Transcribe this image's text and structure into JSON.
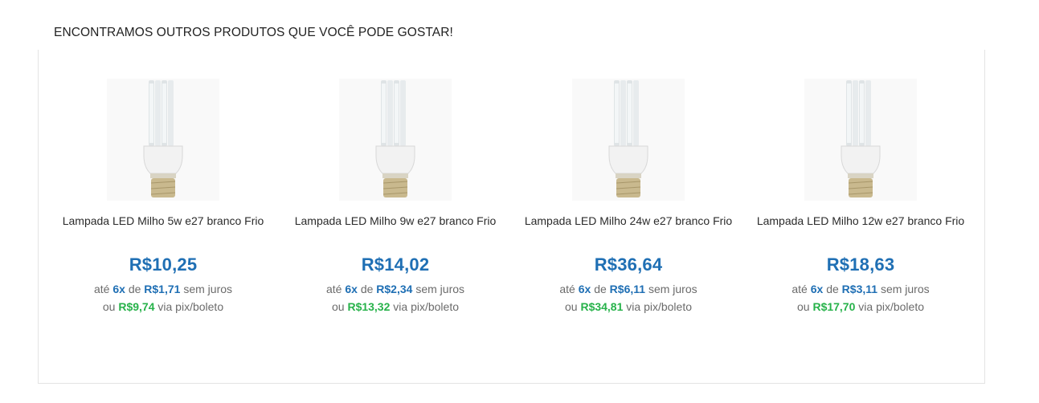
{
  "section": {
    "title": "ENCONTRAMOS OUTROS PRODUTOS QUE VOCÊ PODE GOSTAR!"
  },
  "labels": {
    "ate": "até",
    "de": "de",
    "sem_juros": "sem juros",
    "ou": "ou",
    "via_pix": "via pix/boleto"
  },
  "products": [
    {
      "name": "Lampada LED Milho 5w e27 branco Frio",
      "price": "R$10,25",
      "installments": "6x",
      "installment_value": "R$1,71",
      "pix_price": "R$9,74",
      "image_icon": "led-bulb-icon"
    },
    {
      "name": "Lampada LED Milho 9w e27 branco Frio",
      "price": "R$14,02",
      "installments": "6x",
      "installment_value": "R$2,34",
      "pix_price": "R$13,32",
      "image_icon": "led-bulb-icon"
    },
    {
      "name": "Lampada LED Milho 24w e27 branco Frio",
      "price": "R$36,64",
      "installments": "6x",
      "installment_value": "R$6,11",
      "pix_price": "R$34,81",
      "image_icon": "led-bulb-icon"
    },
    {
      "name": "Lampada LED Milho 12w e27 branco Frio",
      "price": "R$18,63",
      "installments": "6x",
      "installment_value": "R$3,11",
      "pix_price": "R$17,70",
      "image_icon": "led-bulb-icon"
    }
  ],
  "colors": {
    "price_blue": "#1f6fb4",
    "pix_green": "#27b24a",
    "muted_text": "#6b6b6b"
  }
}
